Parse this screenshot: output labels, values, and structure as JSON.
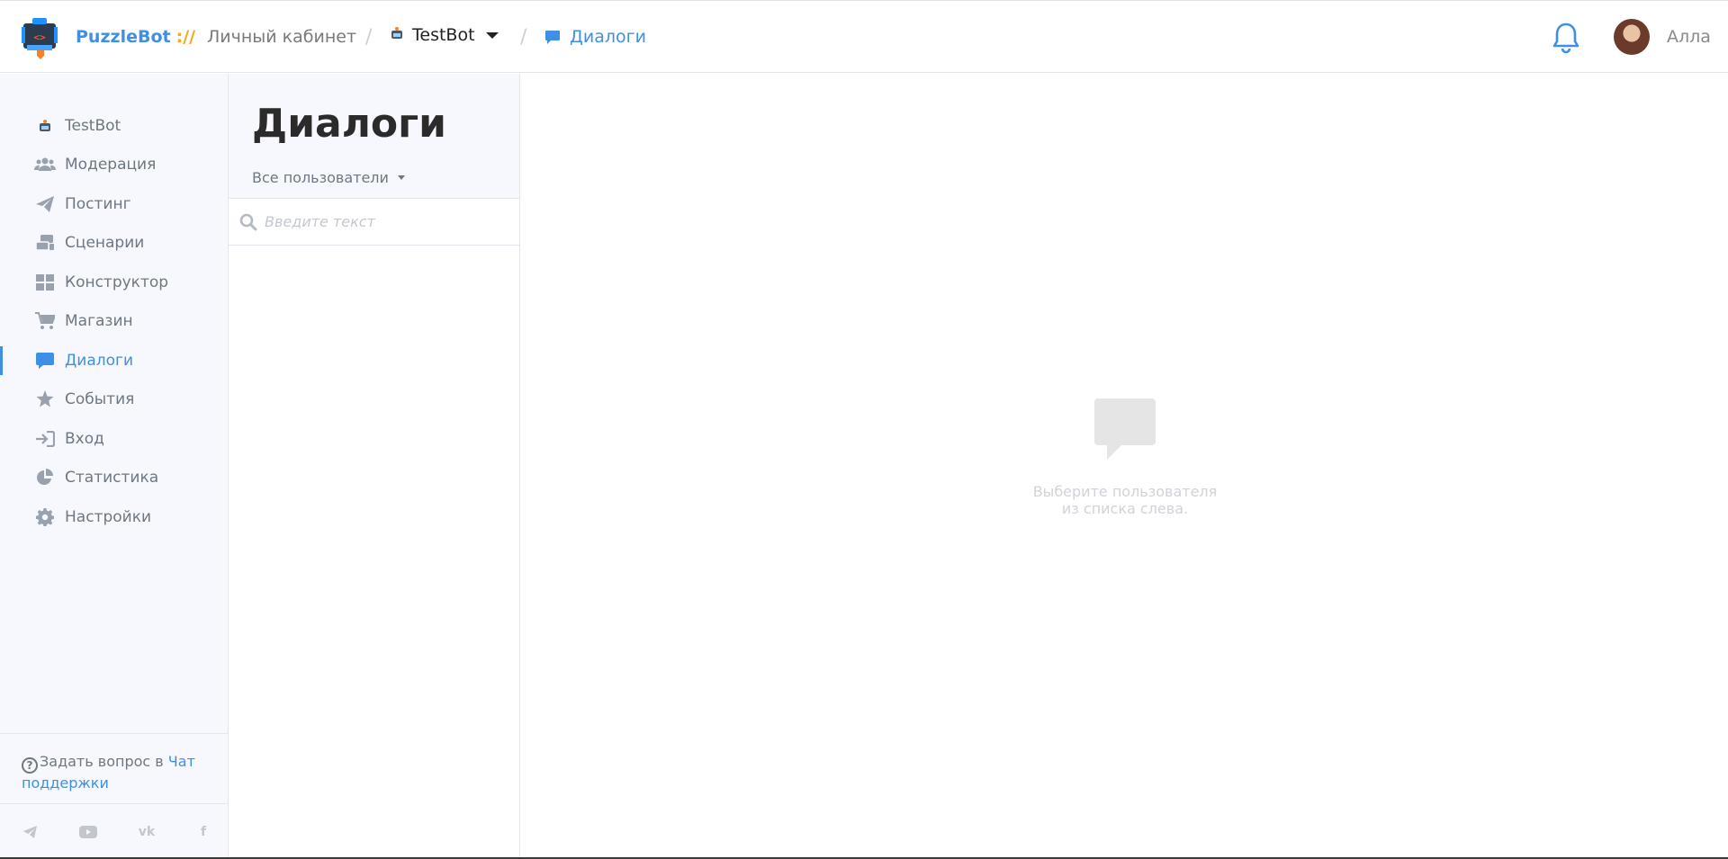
{
  "header": {
    "brand_name": "PuzzleBot",
    "brand_separator": "://",
    "cabinet_label": "Личный кабинет",
    "bot_name": "TestBot",
    "current_section": "Диалоги",
    "user_name": "Алла",
    "accent_color": "#3f8fe6",
    "separator_color": "#f5a623"
  },
  "sidebar": {
    "items": [
      {
        "label": "TestBot",
        "icon": "bot-icon",
        "active": false
      },
      {
        "label": "Модерация",
        "icon": "users-icon",
        "active": false
      },
      {
        "label": "Постинг",
        "icon": "paper-plane-icon",
        "active": false
      },
      {
        "label": "Сценарии",
        "icon": "scenarios-icon",
        "active": false
      },
      {
        "label": "Конструктор",
        "icon": "grid-icon",
        "active": false
      },
      {
        "label": "Магазин",
        "icon": "cart-icon",
        "active": false
      },
      {
        "label": "Диалоги",
        "icon": "chat-icon",
        "active": true
      },
      {
        "label": "События",
        "icon": "star-icon",
        "active": false
      },
      {
        "label": "Вход",
        "icon": "sign-in-icon",
        "active": false
      },
      {
        "label": "Статистика",
        "icon": "pie-chart-icon",
        "active": false
      },
      {
        "label": "Настройки",
        "icon": "gear-icon",
        "active": false
      }
    ],
    "help_text": "Задать вопрос в",
    "help_link_1": "Чат",
    "help_link_2": "поддержки",
    "socials": [
      "telegram-icon",
      "youtube-icon",
      "vk-icon",
      "facebook-icon"
    ]
  },
  "dialogs": {
    "title": "Диалоги",
    "filter_label": "Все пользователи",
    "search_placeholder": "Введите текст",
    "empty_line_1": "Выберите пользователя",
    "empty_line_2": "из списка слева."
  }
}
